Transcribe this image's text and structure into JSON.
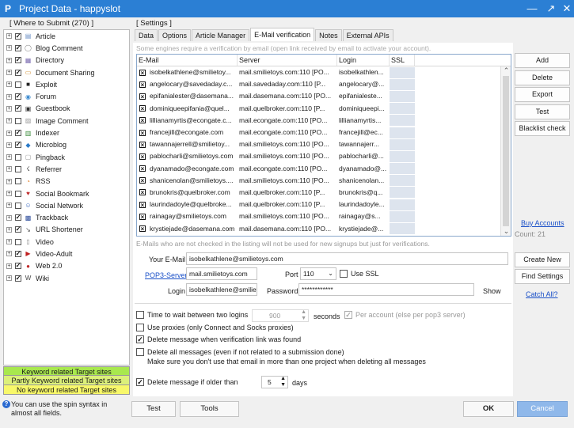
{
  "window": {
    "title": "Project Data - happyslot",
    "icon_glyph": "P"
  },
  "where_to_submit": {
    "header": "[ Where to Submit  (270) ]",
    "items": [
      {
        "label": "Article",
        "checked": true,
        "icon": "article-icon",
        "glyph": "▤",
        "color": "#6b8fc4"
      },
      {
        "label": "Blog Comment",
        "checked": true,
        "icon": "blog-comment-icon",
        "glyph": "◯",
        "color": "#888"
      },
      {
        "label": "Directory",
        "checked": true,
        "icon": "directory-icon",
        "glyph": "▦",
        "color": "#7a6ab0"
      },
      {
        "label": "Document Sharing",
        "checked": true,
        "icon": "document-sharing-icon",
        "glyph": "▭",
        "color": "#d08a2a"
      },
      {
        "label": "Exploit",
        "checked": false,
        "icon": "exploit-icon",
        "glyph": "■",
        "color": "#222"
      },
      {
        "label": "Forum",
        "checked": true,
        "icon": "forum-icon",
        "glyph": "◉",
        "color": "#3a8ad0"
      },
      {
        "label": "Guestbook",
        "checked": true,
        "icon": "guestbook-icon",
        "glyph": "▣",
        "color": "#333"
      },
      {
        "label": "Image Comment",
        "checked": false,
        "icon": "image-comment-icon",
        "glyph": "▨",
        "color": "#999"
      },
      {
        "label": "Indexer",
        "checked": true,
        "icon": "indexer-icon",
        "glyph": "▥",
        "color": "#3a8a3a"
      },
      {
        "label": "Microblog",
        "checked": true,
        "icon": "microblog-icon",
        "glyph": "◆",
        "color": "#2a7ac8"
      },
      {
        "label": "Pingback",
        "checked": false,
        "icon": "pingback-icon",
        "glyph": "▢",
        "color": "#999"
      },
      {
        "label": "Referrer",
        "checked": false,
        "icon": "referrer-icon",
        "glyph": "☇",
        "color": "#333"
      },
      {
        "label": "RSS",
        "checked": false,
        "icon": "rss-icon",
        "glyph": "◔",
        "color": "#e07a20"
      },
      {
        "label": "Social Bookmark",
        "checked": false,
        "icon": "social-bookmark-icon",
        "glyph": "♥",
        "color": "#c03030"
      },
      {
        "label": "Social Network",
        "checked": false,
        "icon": "social-network-icon",
        "glyph": "☺",
        "color": "#3a6ac0"
      },
      {
        "label": "Trackback",
        "checked": true,
        "icon": "trackback-icon",
        "glyph": "▩",
        "color": "#2a4a9a"
      },
      {
        "label": "URL Shortener",
        "checked": true,
        "icon": "url-shortener-icon",
        "glyph": "↘",
        "color": "#555"
      },
      {
        "label": "Video",
        "checked": false,
        "icon": "video-icon",
        "glyph": "▯",
        "color": "#888"
      },
      {
        "label": "Video-Adult",
        "checked": true,
        "icon": "video-adult-icon",
        "glyph": "▶",
        "color": "#c02020"
      },
      {
        "label": "Web 2.0",
        "checked": true,
        "icon": "web20-icon",
        "glyph": "●",
        "color": "#c02a2a"
      },
      {
        "label": "Wiki",
        "checked": true,
        "icon": "wiki-icon",
        "glyph": "W",
        "color": "#444"
      }
    ]
  },
  "legend": {
    "keyword": "Keyword related Target sites",
    "partly": "Partly Keyword related Target sites",
    "none": "No keyword related Target sites"
  },
  "tip": "You can use the spin syntax in almost all fields.",
  "settings": {
    "header": "[ Settings ]",
    "tabs": [
      "Data",
      "Options",
      "Article Manager",
      "E-Mail verification",
      "Notes",
      "External APIs"
    ],
    "active_tab": 3
  },
  "email": {
    "hint": "Some engines require a verification by email (open link received by email to activate your account).",
    "columns": [
      "E-Mail",
      "Server",
      "Login",
      "SSL"
    ],
    "rows": [
      [
        "isobelkathlene@smilietoy...",
        "mail.smilietoys.com:110 [PO...",
        "isobelkathlen..."
      ],
      [
        "angelocary@savedaday.c...",
        "mail.savedaday.com:110 [P...",
        "angelocary@..."
      ],
      [
        "epifanialester@dasemana...",
        "mail.dasemana.com:110 [PO...",
        "epifanialeste..."
      ],
      [
        "dominiqueepifania@quel...",
        "mail.quelbroker.com:110 [P...",
        "dominiqueepi..."
      ],
      [
        "lillianamyrtis@econgate.c...",
        "mail.econgate.com:110 [PO...",
        "lillianamyrtis..."
      ],
      [
        "francejill@econgate.com",
        "mail.econgate.com:110 [PO...",
        "francejill@ec..."
      ],
      [
        "tawannajerrell@smilietoy...",
        "mail.smilietoys.com:110 [PO...",
        "tawannajerr..."
      ],
      [
        "pablocharli@smilietoys.com",
        "mail.smilietoys.com:110 [PO...",
        "pablocharli@..."
      ],
      [
        "dyanamado@econgate.com",
        "mail.econgate.com:110 [PO...",
        "dyanamado@..."
      ],
      [
        "shanicenolan@smilietoys....",
        "mail.smilietoys.com:110 [PO...",
        "shanicenolan..."
      ],
      [
        "brunokris@quelbroker.com",
        "mail.quelbroker.com:110 [P...",
        "brunokris@q..."
      ],
      [
        "laurindadoyle@quelbroke...",
        "mail.quelbroker.com:110 [P...",
        "laurindadoyle..."
      ],
      [
        "rainagay@smilietoys.com",
        "mail.smilietoys.com:110 [PO...",
        "rainagay@s..."
      ],
      [
        "krystiejade@dasemana.com",
        "mail.dasemana.com:110 [PO...",
        "krystiejade@..."
      ]
    ],
    "side_buttons": [
      "Add",
      "Delete",
      "Export",
      "Test",
      "Blacklist check"
    ],
    "buy_accounts": "Buy Accounts",
    "count": "Count: 21",
    "note": "E-Mails who are not checked in the listing will not be used for new signups but just for verifications."
  },
  "form": {
    "your_email_label": "Your E-Mail",
    "your_email_value": "isobelkathlene@smilietoys.com",
    "pop3_link": "POP3-Server",
    "pop3_value": "mail.smilietoys.com",
    "port_label": "Port",
    "port_value": "110",
    "use_ssl": "Use SSL",
    "login_label": "Login",
    "login_value": "isobelkathlene@smiliet",
    "password_label": "Password",
    "password_value": "************",
    "show_label": "Show",
    "create_new": "Create New",
    "find_settings": "Find Settings",
    "catch_all": "Catch All?"
  },
  "options": {
    "wait_label": "Time to wait between two logins",
    "wait_value": "900",
    "seconds": "seconds",
    "per_account": "Per account (else per pop3 server)",
    "use_proxies": "Use proxies (only Connect and Socks proxies)",
    "delete_found": "Delete message when verification link was found",
    "delete_all": "Delete all messages (even if not related to a submission done)",
    "delete_all_note": "Make sure you don't use that email in more than one project when deleting all messages",
    "delete_older": "Delete message if older than",
    "older_value": "5",
    "days": "days"
  },
  "bottom": {
    "test": "Test",
    "tools": "Tools",
    "ok": "OK",
    "cancel": "Cancel"
  }
}
